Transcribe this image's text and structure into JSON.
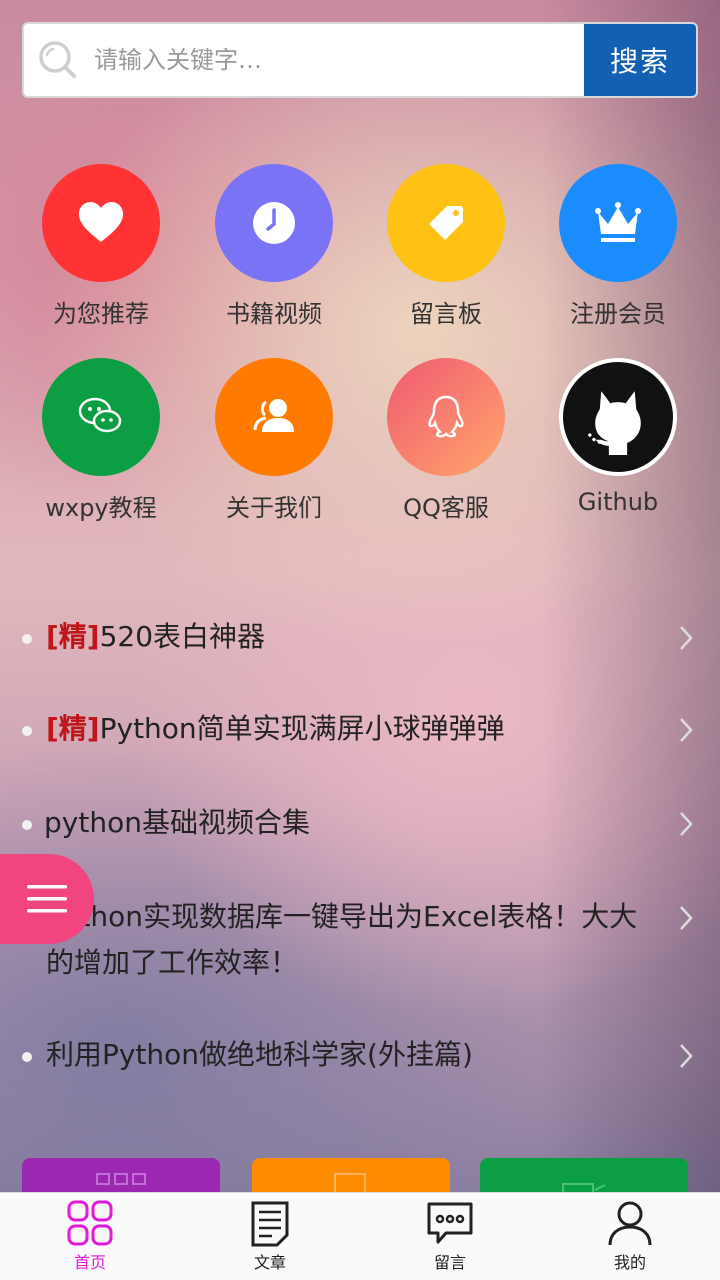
{
  "search": {
    "placeholder": "请输入关键字…",
    "button_label": "搜索"
  },
  "grid": [
    {
      "label": "为您推荐",
      "icon": "heart-icon",
      "color": "#ff3333"
    },
    {
      "label": "书籍视频",
      "icon": "clock-icon",
      "color": "#7b73f5"
    },
    {
      "label": "留言板",
      "icon": "tag-icon",
      "color": "#ffc214"
    },
    {
      "label": "注册会员",
      "icon": "crown-icon",
      "color": "#1a8cff"
    },
    {
      "label": "wxpy教程",
      "icon": "wechat-icon",
      "color": "#0b9e43"
    },
    {
      "label": "关于我们",
      "icon": "users-icon",
      "color": "#ff7a00"
    },
    {
      "label": "QQ客服",
      "icon": "qq-icon",
      "color": "#f56b6b"
    },
    {
      "label": "Github",
      "icon": "github-icon",
      "color": "#111111"
    }
  ],
  "articles": [
    {
      "tag": "[精]",
      "title": "520表白神器"
    },
    {
      "tag": "[精]",
      "title": "Python简单实现满屏小球弹弹弹"
    },
    {
      "tag": "",
      "title": "python基础视频合集"
    },
    {
      "tag": "",
      "title": "Python实现数据库一键导出为Excel表格！大大的增加了工作效率！"
    },
    {
      "tag": "",
      "title": "利用Python做绝地科学家(外挂篇)"
    }
  ],
  "tiles": [
    {
      "color": "#9c27b0"
    },
    {
      "color": "#ff8c00"
    },
    {
      "color": "#0b9e43"
    }
  ],
  "tabs": [
    {
      "label": "首页",
      "icon": "home-grid-icon"
    },
    {
      "label": "文章",
      "icon": "document-icon"
    },
    {
      "label": "留言",
      "icon": "chat-icon"
    },
    {
      "label": "我的",
      "icon": "user-icon"
    }
  ]
}
